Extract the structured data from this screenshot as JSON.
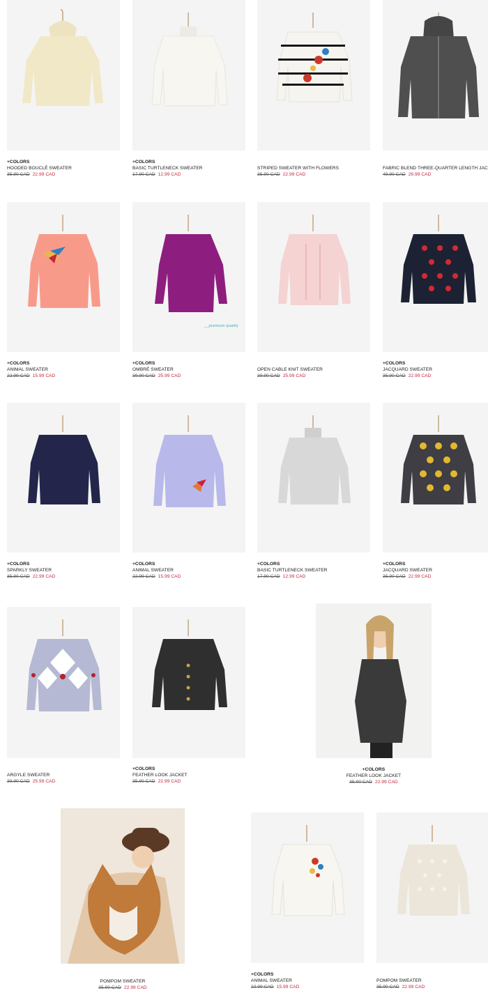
{
  "products": [
    {
      "colors": "+COLORS",
      "name": "HOODED BOUCLÉ SWEATER",
      "old_price": "35.90 CAD",
      "sale_price": "22.99 CAD",
      "image": "hooded-cream-sweater-photo",
      "color": "#f1e8c8"
    },
    {
      "colors": "+COLORS",
      "name": "BASIC TURTLENECK SWEATER",
      "old_price": "17.90 CAD",
      "sale_price": "12.99 CAD",
      "image": "white-turtleneck-photo",
      "color": "#f7f6f1"
    },
    {
      "colors": "",
      "name": "STRIPED SWEATER WITH FLOWERS",
      "old_price": "35.90 CAD",
      "sale_price": "22.99 CAD",
      "image": "striped-flower-sweater-photo",
      "color": "#f6f4ef"
    },
    {
      "colors": "",
      "name": "FABRIC BLEND THREE-QUARTER LENGTH JACKET",
      "old_price": "49.90 CAD",
      "sale_price": "29.99 CAD",
      "image": "grey-knit-jacket-photo",
      "color": "#4f4f4f"
    },
    {
      "colors": "+COLORS",
      "name": "ANIMAL SWEATER",
      "old_price": "22.99 CAD",
      "sale_price": "15.99 CAD",
      "image": "coral-bird-sweater-photo",
      "color": "#f89a8a"
    },
    {
      "colors": "+COLORS",
      "name": "OMBRÉ SWEATER",
      "old_price": "39.90 CAD",
      "sale_price": "25.99 CAD",
      "image": "purple-sweater-dress-photo",
      "color": "#8d1e7f",
      "badge": "__premium quality"
    },
    {
      "colors": "",
      "name": "OPEN CABLE KNIT SWEATER",
      "old_price": "39.90 CAD",
      "sale_price": "25.99 CAD",
      "image": "pink-cable-sweater-photo",
      "color": "#f5d3d3"
    },
    {
      "colors": "+COLORS",
      "name": "JACQUARD SWEATER",
      "old_price": "35.90 CAD",
      "sale_price": "22.99 CAD",
      "image": "navy-hearts-sweater-photo",
      "color": "#1c2233"
    },
    {
      "colors": "+COLORS",
      "name": "SPARKLY SWEATER",
      "old_price": "35.90 CAD",
      "sale_price": "22.99 CAD",
      "image": "navy-sparkly-sweater-photo",
      "color": "#23264a"
    },
    {
      "colors": "+COLORS",
      "name": "ANIMAL SWEATER",
      "old_price": "22.99 CAD",
      "sale_price": "15.99 CAD",
      "image": "lilac-animal-sweater-photo",
      "color": "#b8b9ea"
    },
    {
      "colors": "+COLORS",
      "name": "BASIC TURTLENECK SWEATER",
      "old_price": "17.90 CAD",
      "sale_price": "12.99 CAD",
      "image": "grey-turtleneck-photo",
      "color": "#d8d8d8"
    },
    {
      "colors": "+COLORS",
      "name": "JACQUARD SWEATER",
      "old_price": "35.90 CAD",
      "sale_price": "22.99 CAD",
      "image": "grey-dots-sweater-photo",
      "color": "#3e3e44"
    },
    {
      "colors": "",
      "name": "ARGYLE SWEATER",
      "old_price": "39.90 CAD",
      "sale_price": "25.99 CAD",
      "image": "argyle-sweater-photo",
      "color": "#b5b9d3"
    },
    {
      "colors": "+COLORS",
      "name": "FEATHER LOOK JACKET",
      "old_price": "35.90 CAD",
      "sale_price": "22.99 CAD",
      "image": "black-feather-cardigan-photo",
      "color": "#2f2f2f"
    },
    {
      "colors": "+COLORS",
      "name": "FEATHER LOOK JACKET",
      "old_price": "35.90 CAD",
      "sale_price": "22.99 CAD",
      "image": "girl-in-feather-cardigan-photo",
      "color": "#3a3a3a"
    },
    {
      "colors": "",
      "name": "POMPOM SWEATER",
      "old_price": "35.90 CAD",
      "sale_price": "22.99 CAD",
      "image": "girl-with-corgi-photo",
      "color": "#e2c7a8"
    },
    {
      "colors": "+COLORS",
      "name": "ANIMAL SWEATER",
      "old_price": "22.99 CAD",
      "sale_price": "15.99 CAD",
      "image": "white-flower-sweater-photo",
      "color": "#f8f6f0"
    },
    {
      "colors": "",
      "name": "POMPOM SWEATER",
      "old_price": "35.90 CAD",
      "sale_price": "22.99 CAD",
      "image": "beige-pompom-sweater-photo",
      "color": "#ece5da"
    }
  ],
  "colors": {
    "sale": "#c0263b",
    "image_bg": "#f4f4f4",
    "badge": "#3aa9bf"
  }
}
